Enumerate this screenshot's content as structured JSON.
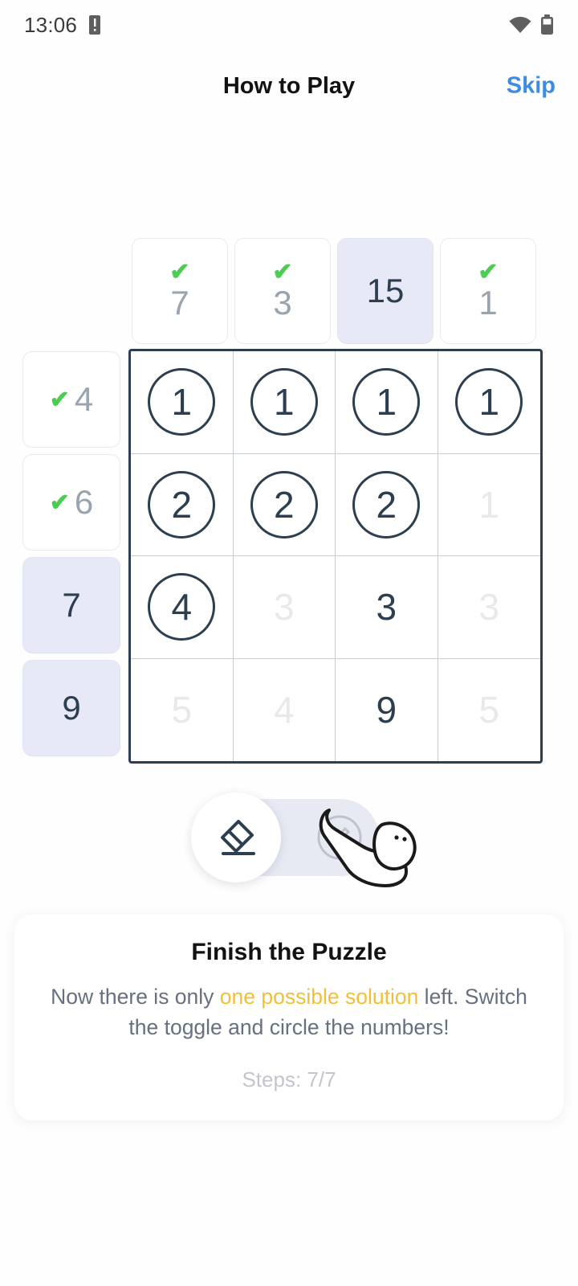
{
  "status_bar": {
    "time": "13:06",
    "notification_icon": "notification-badge-icon",
    "wifi_icon": "wifi-icon",
    "battery_icon": "battery-icon"
  },
  "header": {
    "title": "How to Play",
    "skip_label": "Skip"
  },
  "puzzle": {
    "column_headers": [
      {
        "value": "7",
        "checked": true,
        "highlighted": false
      },
      {
        "value": "3",
        "checked": true,
        "highlighted": false
      },
      {
        "value": "15",
        "checked": false,
        "highlighted": true
      },
      {
        "value": "1",
        "checked": true,
        "highlighted": false
      }
    ],
    "row_headers": [
      {
        "value": "4",
        "checked": true,
        "highlighted": false
      },
      {
        "value": "6",
        "checked": true,
        "highlighted": false
      },
      {
        "value": "7",
        "checked": false,
        "highlighted": true
      },
      {
        "value": "9",
        "checked": false,
        "highlighted": true
      }
    ],
    "grid": [
      [
        {
          "value": "1",
          "circled": true,
          "faded": false
        },
        {
          "value": "1",
          "circled": true,
          "faded": false
        },
        {
          "value": "1",
          "circled": true,
          "faded": false
        },
        {
          "value": "1",
          "circled": true,
          "faded": false
        }
      ],
      [
        {
          "value": "2",
          "circled": true,
          "faded": false
        },
        {
          "value": "2",
          "circled": true,
          "faded": false
        },
        {
          "value": "2",
          "circled": true,
          "faded": false
        },
        {
          "value": "1",
          "circled": false,
          "faded": true
        }
      ],
      [
        {
          "value": "4",
          "circled": true,
          "faded": false
        },
        {
          "value": "3",
          "circled": false,
          "faded": true
        },
        {
          "value": "3",
          "circled": false,
          "faded": false
        },
        {
          "value": "3",
          "circled": false,
          "faded": true
        }
      ],
      [
        {
          "value": "5",
          "circled": false,
          "faded": true
        },
        {
          "value": "4",
          "circled": false,
          "faded": true
        },
        {
          "value": "9",
          "circled": false,
          "faded": false
        },
        {
          "value": "5",
          "circled": false,
          "faded": true
        }
      ]
    ]
  },
  "toggle": {
    "active_option": "eraser",
    "left_icon": "eraser-icon",
    "right_icon": "circle-pencil-icon",
    "pointer": "hand-pointer-icon"
  },
  "instruction_card": {
    "title": "Finish the Puzzle",
    "body_part1": "Now there is only ",
    "body_highlight": "one possible solution",
    "body_part2": " left. Switch the toggle and circle the numbers!",
    "steps": "Steps: 7/7"
  },
  "colors": {
    "accent_blue": "#3d8ce0",
    "check_green": "#4ccc52",
    "highlight_yellow": "#f0c03a",
    "navy": "#2c3e50",
    "selected_bg": "#e7eaf6",
    "muted_grey": "#9aa4ae"
  }
}
